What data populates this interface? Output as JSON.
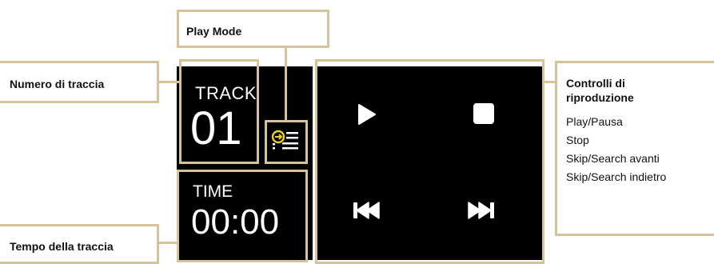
{
  "callouts": {
    "play_mode": "Play Mode",
    "track_number": "Numero di traccia",
    "track_time": "Tempo della traccia",
    "controls_title": "Controlli di riproduzione",
    "controls_items": [
      "Play/Pausa",
      "Stop",
      "Skip/Search avanti",
      "Skip/Search indietro"
    ]
  },
  "display": {
    "track_label": "TRACK",
    "track_value": "01",
    "time_label": "TIME",
    "time_value": "00:00"
  },
  "colors": {
    "frame": "#d5c49a",
    "screen": "#000000",
    "play_mode_icon": "#f2d21b"
  },
  "icons": [
    "play-icon",
    "stop-icon",
    "skip-back-icon",
    "skip-forward-icon",
    "play-mode-icon"
  ]
}
